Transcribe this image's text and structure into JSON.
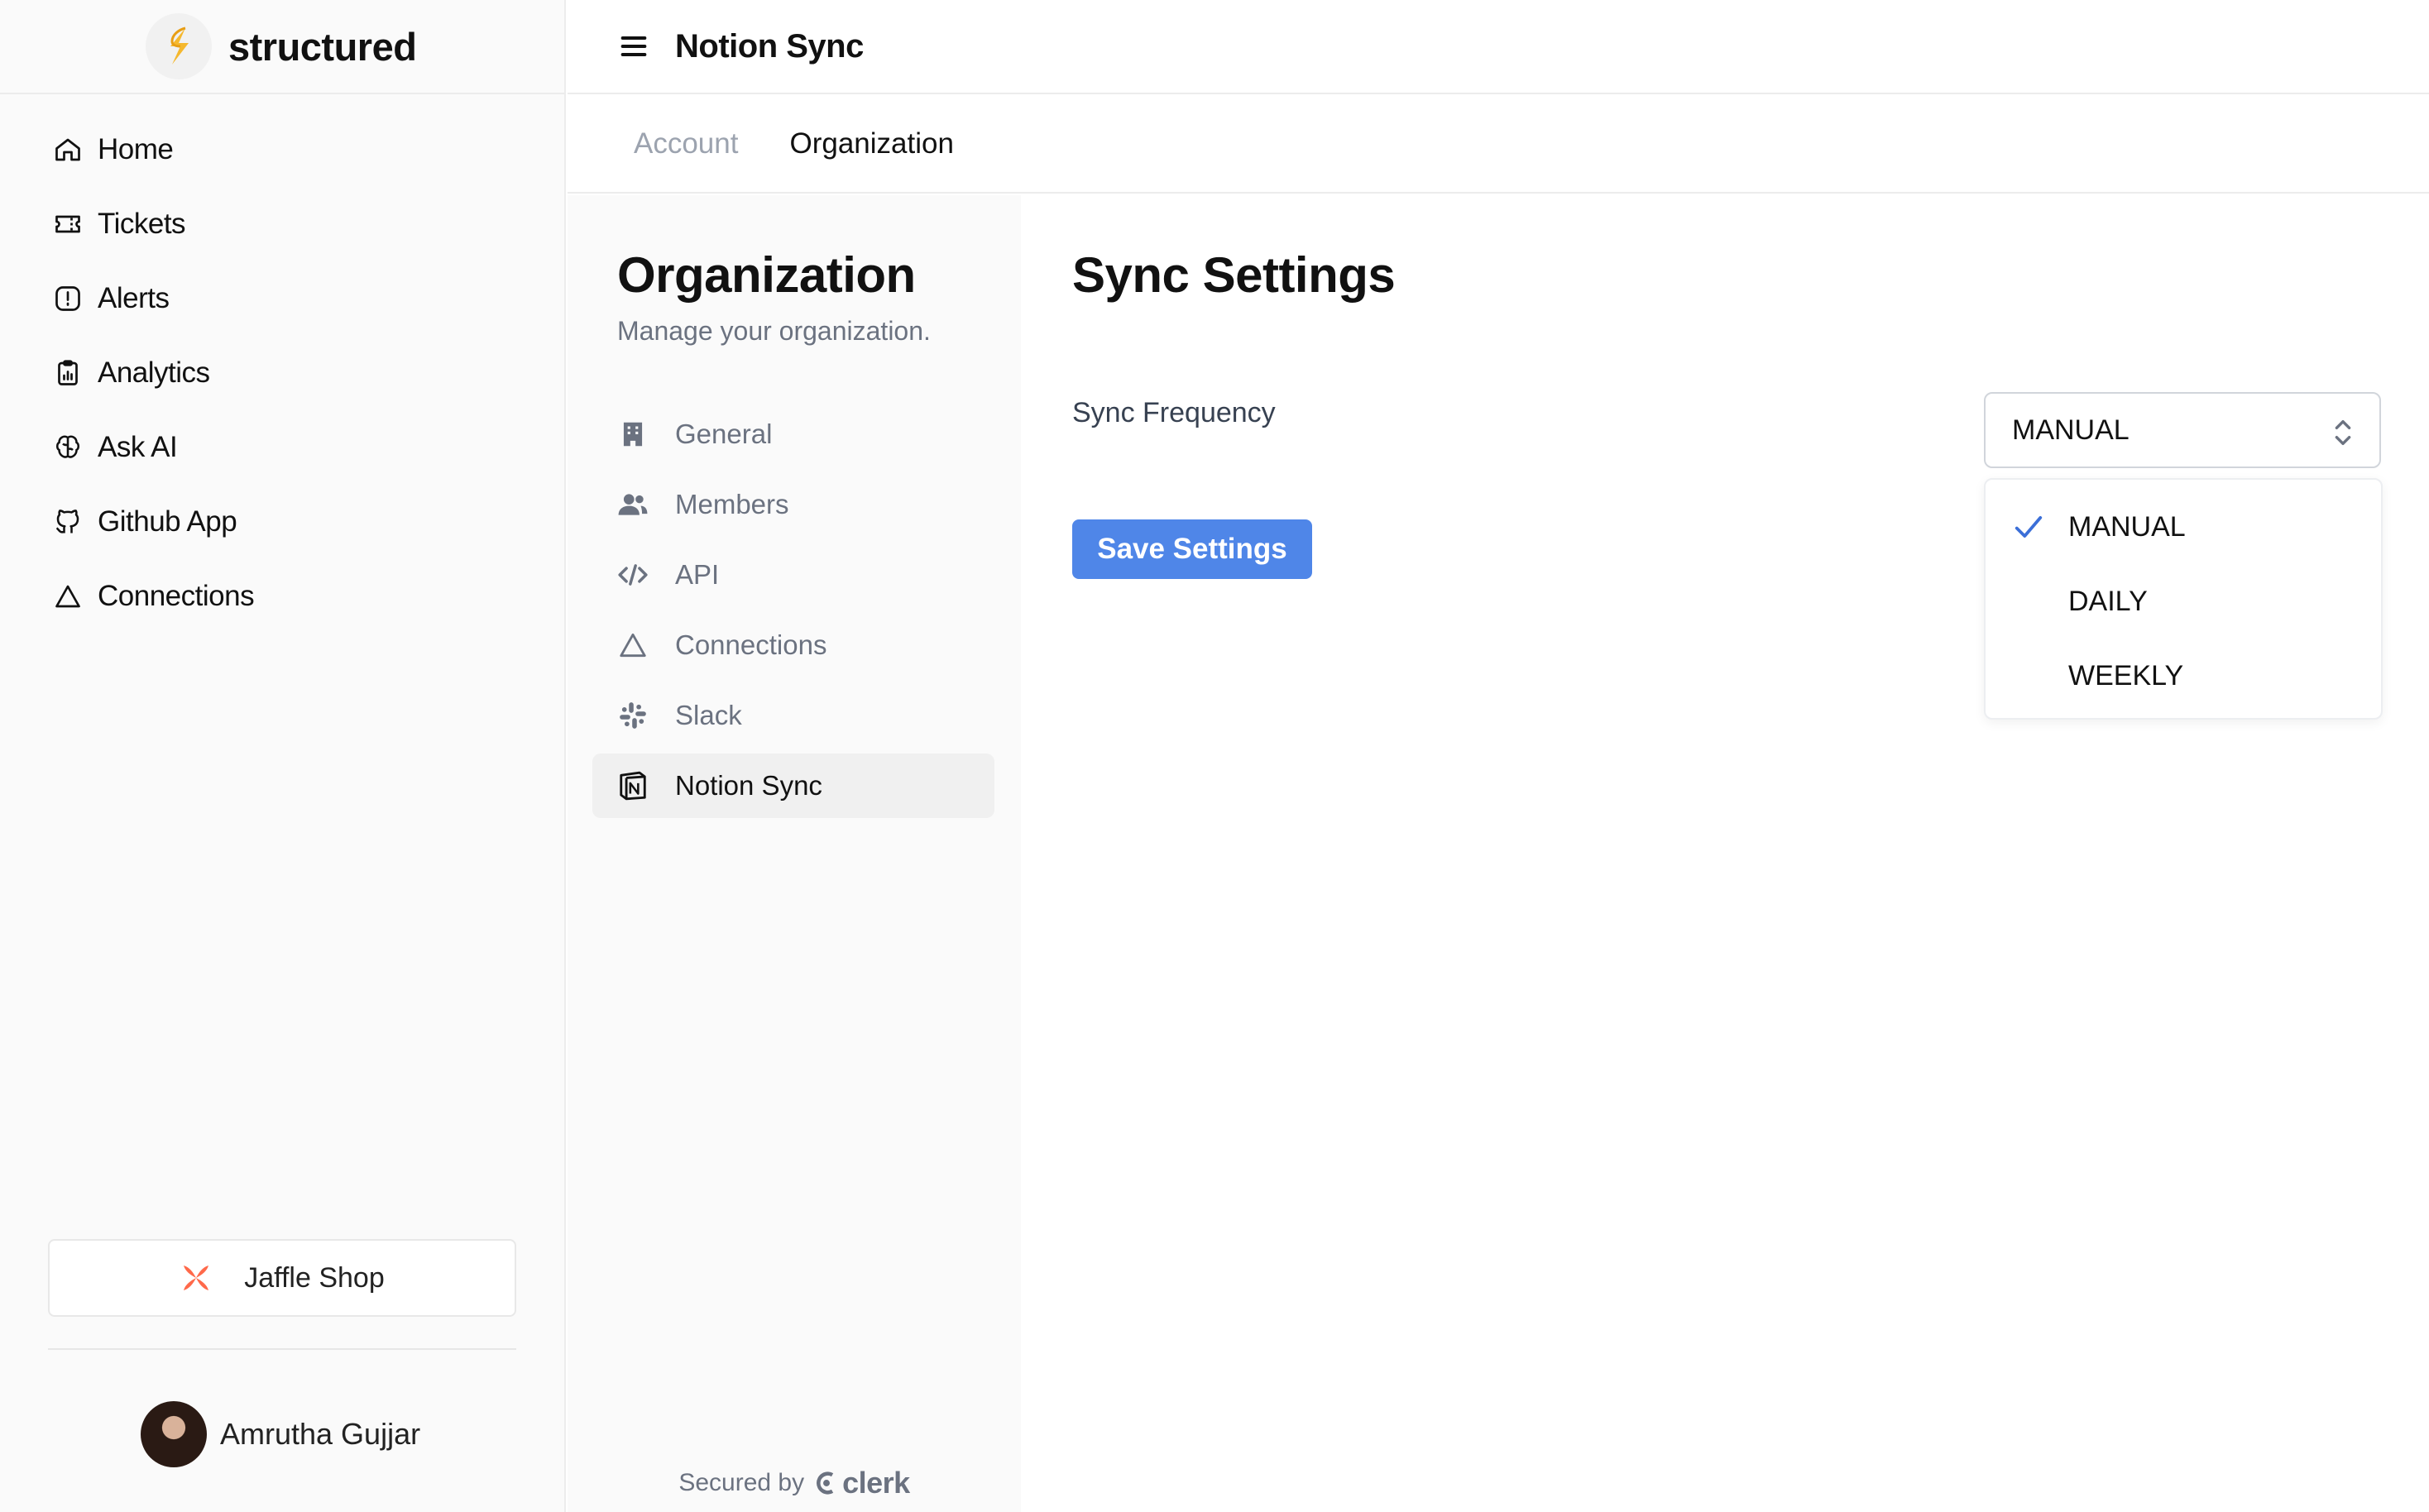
{
  "brand": {
    "name": "structured"
  },
  "sidebar": {
    "items": [
      {
        "label": "Home",
        "icon": "home-icon"
      },
      {
        "label": "Tickets",
        "icon": "ticket-icon"
      },
      {
        "label": "Alerts",
        "icon": "alert-icon"
      },
      {
        "label": "Analytics",
        "icon": "clipboard-chart-icon"
      },
      {
        "label": "Ask AI",
        "icon": "brain-icon"
      },
      {
        "label": "Github App",
        "icon": "github-icon"
      },
      {
        "label": "Connections",
        "icon": "triangle-icon"
      }
    ],
    "org_switcher": {
      "label": "Jaffle Shop",
      "icon": "dbt-logo-icon"
    },
    "user": {
      "name": "Amrutha Gujjar"
    }
  },
  "header": {
    "title": "Notion Sync",
    "menu_icon": "hamburger-icon"
  },
  "tabs": [
    {
      "label": "Account",
      "active": false
    },
    {
      "label": "Organization",
      "active": true
    }
  ],
  "org_panel": {
    "title": "Organization",
    "subtitle": "Manage your organization.",
    "items": [
      {
        "label": "General",
        "icon": "building-icon",
        "active": false
      },
      {
        "label": "Members",
        "icon": "users-icon",
        "active": false
      },
      {
        "label": "API",
        "icon": "code-icon",
        "active": false
      },
      {
        "label": "Connections",
        "icon": "triangle-icon",
        "active": false
      },
      {
        "label": "Slack",
        "icon": "slack-icon",
        "active": false
      },
      {
        "label": "Notion Sync",
        "icon": "notion-icon",
        "active": true
      }
    ],
    "secured_by": "Secured by",
    "secured_brand": "clerk"
  },
  "main": {
    "title": "Sync Settings",
    "frequency_label": "Sync Frequency",
    "frequency_value": "MANUAL",
    "options": [
      "MANUAL",
      "DAILY",
      "WEEKLY"
    ],
    "selected_option": "MANUAL",
    "save_label": "Save Settings"
  },
  "colors": {
    "accent": "#4f86e8",
    "check": "#3b6fd8",
    "brand_logo": "#f5b82e",
    "org_logo": "#ff694a"
  }
}
